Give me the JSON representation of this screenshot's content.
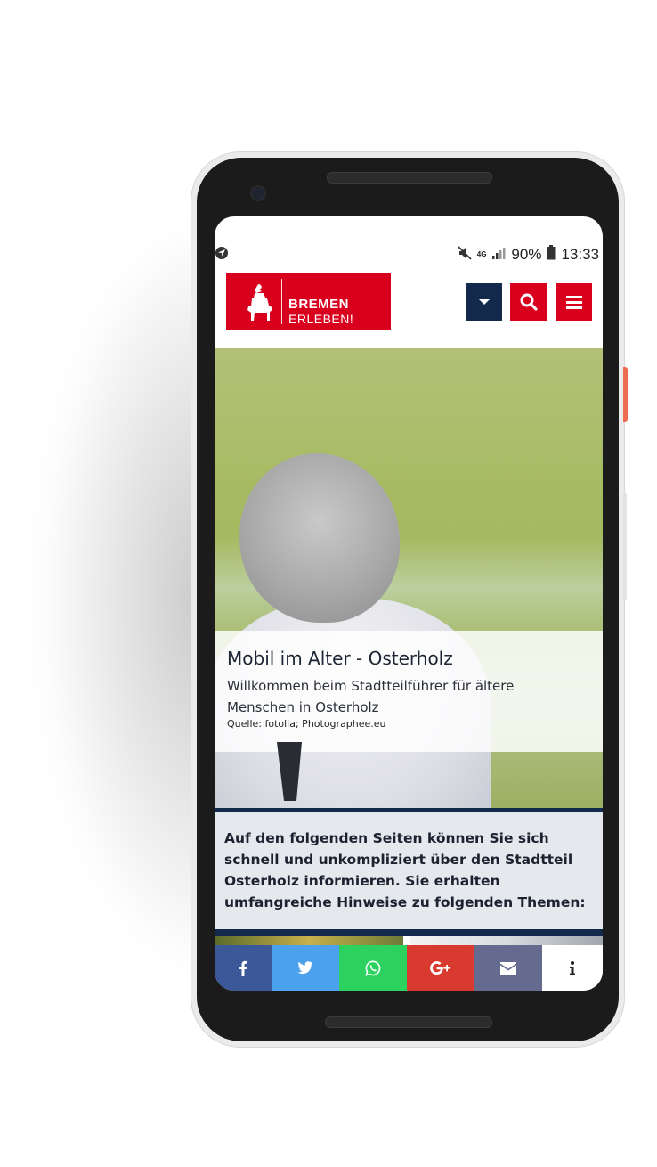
{
  "status_bar": {
    "network": "4G",
    "battery": "90%",
    "time": "13:33"
  },
  "header": {
    "logo_line1": "BREMEN",
    "logo_line2": "ERLEBEN!",
    "buttons": [
      "dropdown",
      "search",
      "menu"
    ],
    "colors": {
      "brand_red": "#d9001e",
      "navy": "#13294b"
    }
  },
  "hero": {
    "title": "Mobil im Alter - Osterholz",
    "subtitle": "Willkommen beim Stadtteilführer für ältere Menschen in Osterholz",
    "source": "Quelle: fotolia; Photographee.eu"
  },
  "intro": {
    "text": "Auf den folgenden Seiten können Sie sich schnell und unkompliziert über den Stadtteil Osterholz informieren. Sie erhalten umfangreiche Hinweise zu folgenden Themen:"
  },
  "share_bar": {
    "icons": [
      "facebook-icon",
      "twitter-icon",
      "whatsapp-icon",
      "google-plus-icon",
      "email-icon",
      "info-icon"
    ]
  }
}
